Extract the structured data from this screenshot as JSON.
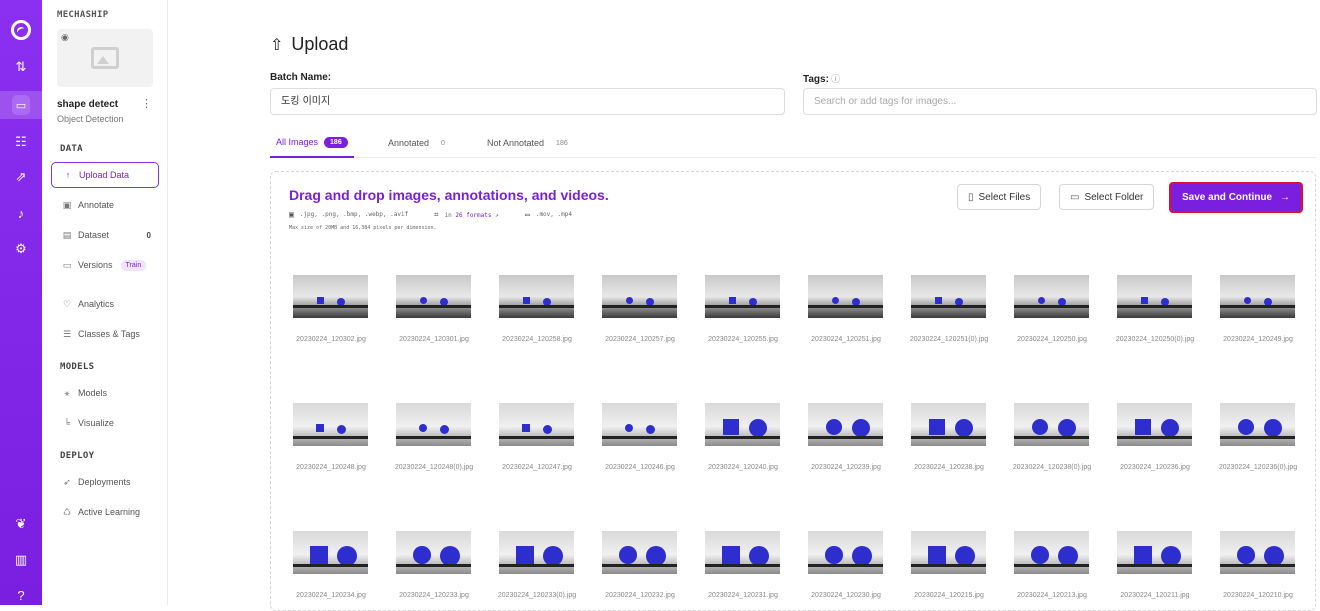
{
  "rail": {
    "icons": [
      "logo-icon",
      "upload-download-icon",
      "inbox-icon",
      "hierarchy-icon",
      "trend-icon",
      "bell-icon",
      "settings-icon",
      "leaf-icon",
      "library-icon",
      "help-icon"
    ]
  },
  "sidebar": {
    "workspace": "MECHASHIP",
    "project_name": "shape detect",
    "project_type": "Object Detection",
    "sections": {
      "data": "DATA",
      "models": "MODELS",
      "deploy": "DEPLOY"
    },
    "items": {
      "upload": "Upload Data",
      "annotate": "Annotate",
      "dataset": "Dataset",
      "dataset_count": "0",
      "versions": "Versions",
      "versions_pill": "Train",
      "analytics": "Analytics",
      "classes": "Classes & Tags",
      "models": "Models",
      "visualize": "Visualize",
      "deployments": "Deployments",
      "active_learning": "Active Learning"
    }
  },
  "main": {
    "title": "Upload",
    "batch_label": "Batch Name:",
    "batch_value": "도킹 이미지",
    "tags_label": "Tags:",
    "tags_placeholder": "Search or add tags for images...",
    "tabs": {
      "all": "All Images",
      "all_count": "186",
      "annotated": "Annotated",
      "annotated_count": "0",
      "not_annotated": "Not Annotated",
      "not_annotated_count": "186"
    },
    "dropzone": {
      "title": "Drag and drop images, annotations, and videos.",
      "image_formats": ".jpg, .png, .bmp, .webp, .avif",
      "annotation_prefix": "in",
      "annotation_link": "26 formats",
      "video_formats": ".mov, .mp4",
      "max_size": "Max size of 20MB and 16,384 pixels per dimension."
    },
    "buttons": {
      "select_files": "Select Files",
      "select_folder": "Select Folder",
      "save_continue": "Save and Continue"
    },
    "images": [
      "20230224_120302.jpg",
      "20230224_120301.jpg",
      "20230224_120258.jpg",
      "20230224_120257.jpg",
      "20230224_120255.jpg",
      "20230224_120251.jpg",
      "20230224_120251(0).jpg",
      "20230224_120250.jpg",
      "20230224_120250(0).jpg",
      "20230224_120249.jpg",
      "20230224_120248.jpg",
      "20230224_120248(0).jpg",
      "20230224_120247.jpg",
      "20230224_120246.jpg",
      "20230224_120240.jpg",
      "20230224_120239.jpg",
      "20230224_120238.jpg",
      "20230224_120238(0).jpg",
      "20230224_120236.jpg",
      "20230224_120236(0).jpg",
      "20230224_120234.jpg",
      "20230224_120233.jpg",
      "20230224_120233(0).jpg",
      "20230224_120232.jpg",
      "20230224_120231.jpg",
      "20230224_120230.jpg",
      "20230224_120215.jpg",
      "20230224_120213.jpg",
      "20230224_120211.jpg",
      "20230224_120210.jpg"
    ]
  }
}
